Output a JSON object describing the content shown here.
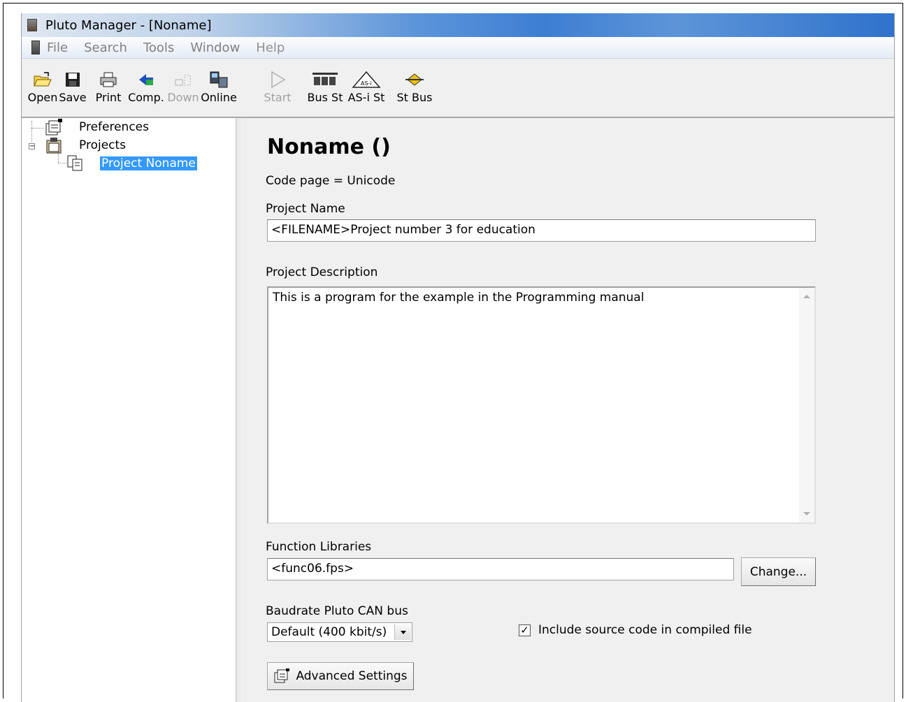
{
  "window": {
    "title": "Pluto Manager - [Noname]"
  },
  "menu": {
    "items": [
      "File",
      "Search",
      "Tools",
      "Window",
      "Help"
    ]
  },
  "toolbar": {
    "open": "Open",
    "save": "Save",
    "print": "Print",
    "comp": "Comp.",
    "down": "Down",
    "online": "Online",
    "start": "Start",
    "bus_st": "Bus St",
    "asi_st": "AS-i St",
    "st_bus": "St Bus"
  },
  "tree": {
    "preferences": "Preferences",
    "projects": "Projects",
    "project_noname": "Project Noname"
  },
  "content": {
    "title": "Noname ()",
    "code_page": "Code page = Unicode",
    "project_name_label": "Project Name",
    "project_name_value": "<FILENAME>Project number 3 for education",
    "project_description_label": "Project Description",
    "project_description_value": "This is a program for the example in the Programming manual",
    "function_libraries_label": "Function Libraries",
    "function_libraries_value": "<func06.fps>",
    "change_button": "Change...",
    "baudrate_label": "Baudrate Pluto CAN bus",
    "baudrate_value": "Default (400 kbit/s)",
    "include_source_label": "Include source code in compiled file",
    "include_source_checked": true,
    "advanced_settings_button": "Advanced Settings"
  },
  "colors": {
    "selection": "#3399ff",
    "titlebar": "#3d7ed3",
    "panel_bg": "#f0f0f0"
  }
}
